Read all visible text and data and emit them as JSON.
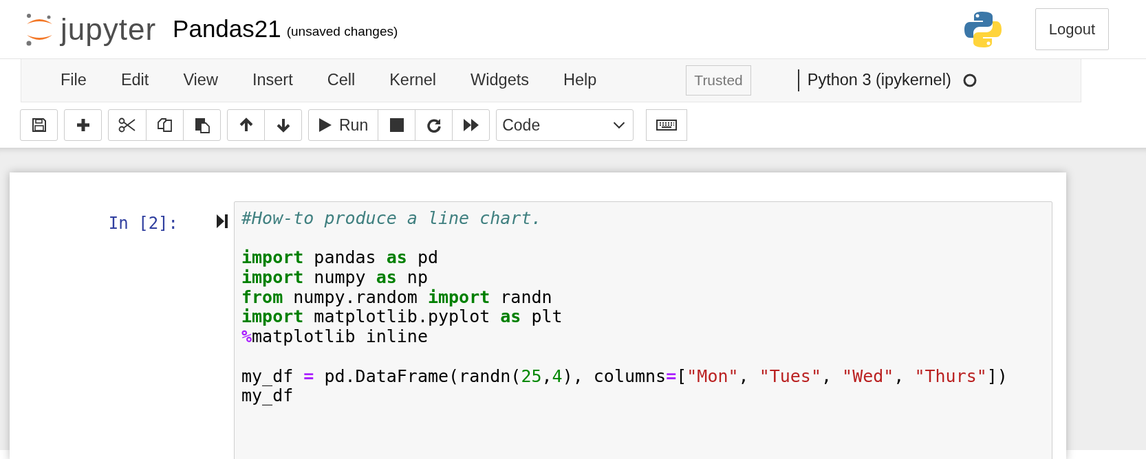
{
  "header": {
    "logo_text": "jupyter",
    "notebook_name": "Pandas21",
    "save_status": "(unsaved changes)",
    "logout": "Logout"
  },
  "menubar": {
    "items": [
      "File",
      "Edit",
      "View",
      "Insert",
      "Cell",
      "Kernel",
      "Widgets",
      "Help"
    ],
    "trusted": "Trusted",
    "kernel": {
      "name": "Python 3 (ipykernel)",
      "busy": false
    }
  },
  "toolbar": {
    "groups": [
      [
        {
          "kind": "save"
        }
      ],
      [
        {
          "kind": "add"
        }
      ],
      [
        {
          "kind": "cut"
        },
        {
          "kind": "copy"
        },
        {
          "kind": "paste"
        }
      ],
      [
        {
          "kind": "up"
        },
        {
          "kind": "down"
        }
      ],
      [
        {
          "kind": "run",
          "label": "Run"
        },
        {
          "kind": "stop"
        },
        {
          "kind": "restart"
        },
        {
          "kind": "fastforward"
        }
      ]
    ],
    "cell_type": "Code"
  },
  "cell": {
    "prompt": "In [2]:",
    "lines": [
      {
        "kind": "code",
        "tokens": [
          {
            "kind": "comment",
            "text": "#How-to produce a line chart."
          }
        ]
      },
      {
        "kind": "blank"
      },
      {
        "kind": "code",
        "tokens": [
          {
            "kind": "keyword",
            "text": "import"
          },
          {
            "kind": "plain",
            "text": " pandas "
          },
          {
            "kind": "keyword",
            "text": "as"
          },
          {
            "kind": "plain",
            "text": " pd"
          }
        ]
      },
      {
        "kind": "code",
        "tokens": [
          {
            "kind": "keyword",
            "text": "import"
          },
          {
            "kind": "plain",
            "text": " numpy "
          },
          {
            "kind": "keyword",
            "text": "as"
          },
          {
            "kind": "plain",
            "text": " np"
          }
        ]
      },
      {
        "kind": "code",
        "tokens": [
          {
            "kind": "keyword",
            "text": "from"
          },
          {
            "kind": "plain",
            "text": " numpy.random "
          },
          {
            "kind": "keyword",
            "text": "import"
          },
          {
            "kind": "plain",
            "text": " randn"
          }
        ]
      },
      {
        "kind": "code",
        "tokens": [
          {
            "kind": "keyword",
            "text": "import"
          },
          {
            "kind": "plain",
            "text": " matplotlib.pyplot "
          },
          {
            "kind": "keyword",
            "text": "as"
          },
          {
            "kind": "plain",
            "text": " plt"
          }
        ]
      },
      {
        "kind": "code",
        "tokens": [
          {
            "kind": "operator",
            "text": "%"
          },
          {
            "kind": "plain",
            "text": "matplotlib inline"
          }
        ]
      },
      {
        "kind": "blank"
      },
      {
        "kind": "code",
        "tokens": [
          {
            "kind": "plain",
            "text": "my_df "
          },
          {
            "kind": "operator",
            "text": "="
          },
          {
            "kind": "plain",
            "text": " pd.DataFrame(randn("
          },
          {
            "kind": "number",
            "text": "25"
          },
          {
            "kind": "plain",
            "text": ","
          },
          {
            "kind": "number",
            "text": "4"
          },
          {
            "kind": "plain",
            "text": "), columns"
          },
          {
            "kind": "operator",
            "text": "="
          },
          {
            "kind": "plain",
            "text": "["
          },
          {
            "kind": "string",
            "text": "\"Mon\""
          },
          {
            "kind": "plain",
            "text": ", "
          },
          {
            "kind": "string",
            "text": "\"Tues\""
          },
          {
            "kind": "plain",
            "text": ", "
          },
          {
            "kind": "string",
            "text": "\"Wed\""
          },
          {
            "kind": "plain",
            "text": ", "
          },
          {
            "kind": "string",
            "text": "\"Thurs\""
          },
          {
            "kind": "plain",
            "text": "])"
          }
        ]
      },
      {
        "kind": "code",
        "tokens": [
          {
            "kind": "plain",
            "text": "my_df"
          }
        ]
      }
    ]
  }
}
